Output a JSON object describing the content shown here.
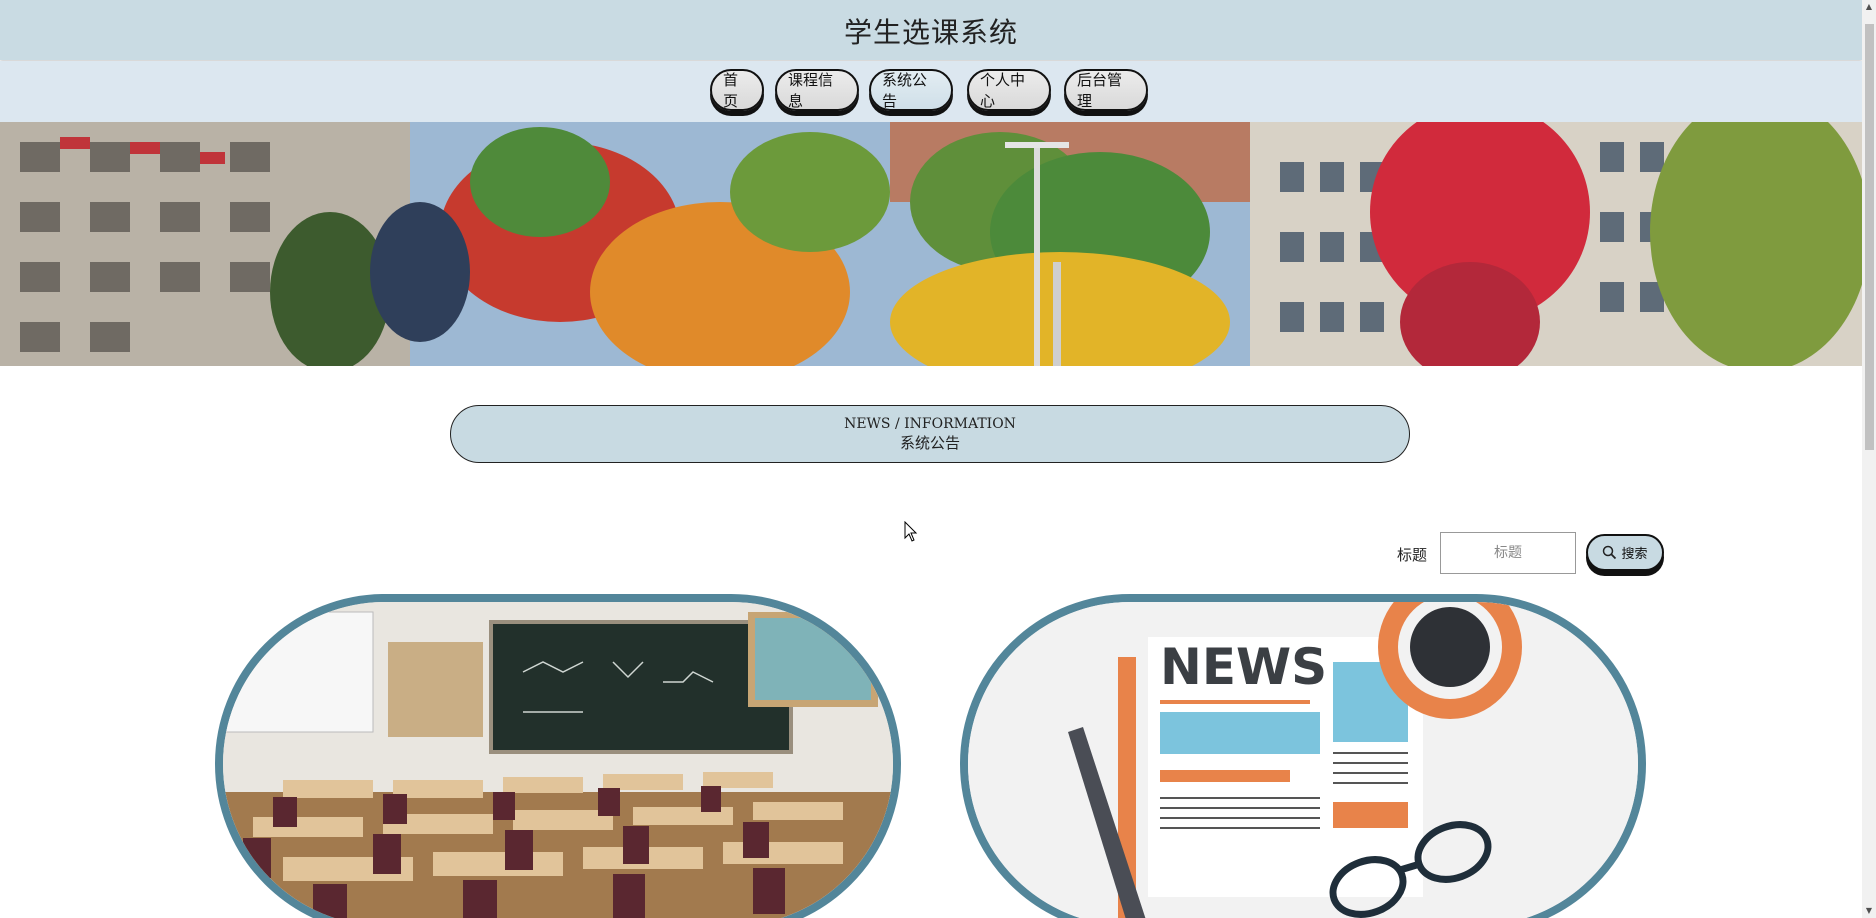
{
  "site": {
    "title": "学生选课系统"
  },
  "nav": {
    "items": [
      {
        "label": "首页",
        "active": false
      },
      {
        "label": "课程信息",
        "active": false
      },
      {
        "label": "系统公告",
        "active": true
      },
      {
        "label": "个人中心",
        "active": false
      },
      {
        "label": "后台管理",
        "active": false
      }
    ]
  },
  "section": {
    "title_en": "NEWS / INFORMATION",
    "title_cn": "系统公告"
  },
  "search": {
    "label": "标题",
    "placeholder": "标题",
    "button_label": "搜索",
    "button_icon": "search-icon"
  },
  "cards": [
    {
      "image": "classroom-photo"
    },
    {
      "image": "news-illustration",
      "image_text": "NEWS"
    }
  ],
  "colors": {
    "title_bar": "#c9dbe3",
    "nav_bar": "#dce7f0",
    "card_border": "#53869a",
    "pill_bg": "#c8dae2"
  }
}
